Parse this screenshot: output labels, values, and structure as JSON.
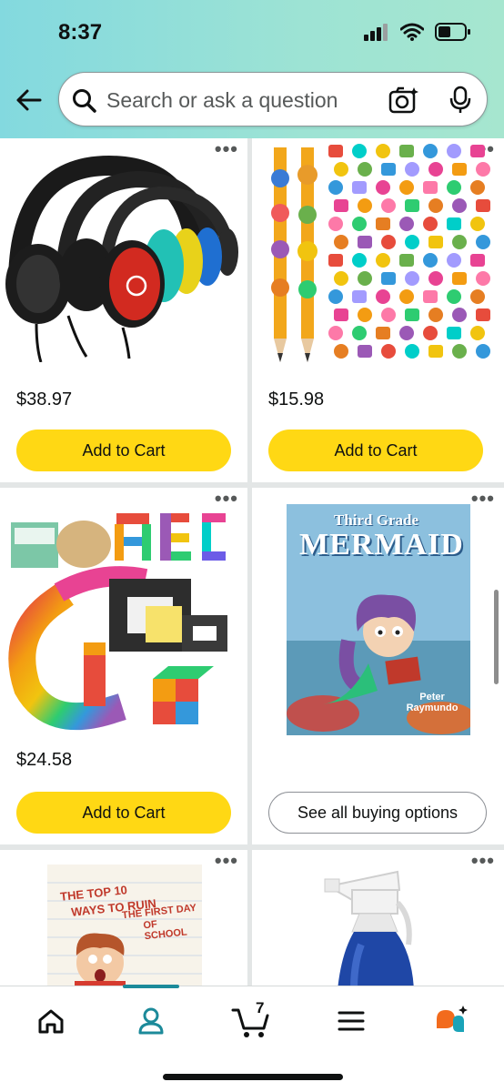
{
  "status_bar": {
    "time": "8:37"
  },
  "search": {
    "placeholder": "Search or ask a question"
  },
  "products": [
    {
      "price": "$38.97",
      "action": "Add to Cart"
    },
    {
      "price": "$15.98",
      "action": "Add to Cart"
    },
    {
      "price": "$24.58",
      "action": "Add to Cart"
    },
    {
      "price": "",
      "action": "See all buying options"
    }
  ],
  "book": {
    "title_line1": "Third Grade",
    "title_line2": "MERMAID",
    "author": "Peter Raymundo"
  },
  "book2": {
    "line1": "THE TOP 10",
    "line2": "WAYS TO RUIN",
    "line3": "THE FIRST DAY",
    "line4": "OF SCHOOL"
  },
  "nav": {
    "cart_count": "7"
  },
  "colors": {
    "accent": "#1c8a9a",
    "button_yellow": "#ffd814",
    "header_start": "#83d9df",
    "header_end": "#a6e6cf"
  }
}
